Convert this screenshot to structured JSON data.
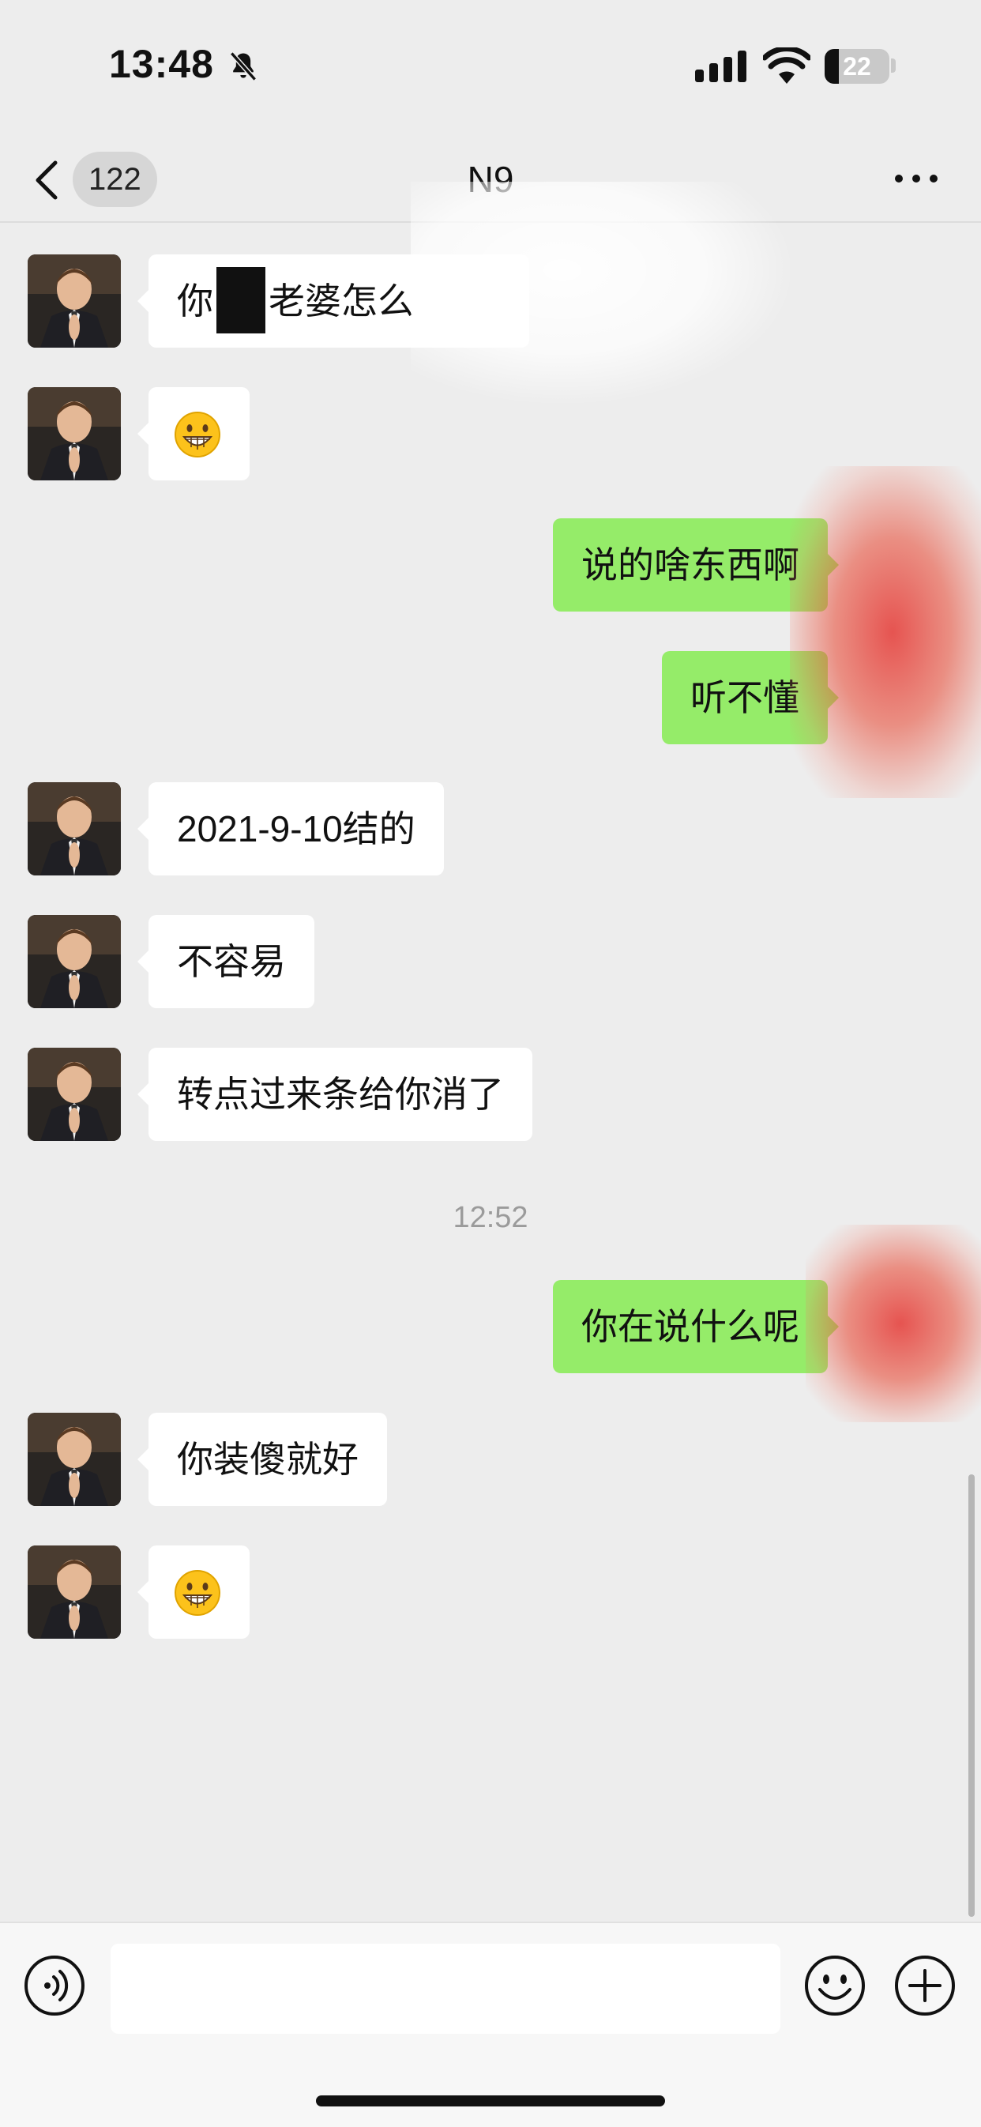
{
  "status_bar": {
    "time": "13:48",
    "battery_percent": "22",
    "icons": [
      "bell-slash-icon",
      "cellular-signal-icon",
      "wifi-icon",
      "battery-icon"
    ]
  },
  "nav": {
    "back_icon": "chevron-left-icon",
    "unread_count": "122",
    "title": "N9",
    "more_icon": "ellipsis-icon"
  },
  "messages": [
    {
      "side": "left",
      "text_before": "你",
      "text_after": "老婆怎么",
      "redacted": true
    },
    {
      "side": "left",
      "emoji": "grinning-face-icon"
    },
    {
      "side": "right",
      "text": "说的啥东西啊"
    },
    {
      "side": "right",
      "text": "听不懂"
    },
    {
      "side": "left",
      "text": "2021-9-10结的"
    },
    {
      "side": "left",
      "text": "不容易"
    },
    {
      "side": "left",
      "text": "转点过来条给你消了"
    },
    {
      "side": "right",
      "text": "你在说什么呢"
    },
    {
      "side": "left",
      "text": "你装傻就好"
    },
    {
      "side": "left",
      "emoji": "grinning-face-icon"
    }
  ],
  "timestamp": "12:52",
  "input_bar": {
    "voice_icon": "voice-icon",
    "input_value": "",
    "emoji_icon": "smiley-icon",
    "plus_icon": "plus-circle-icon"
  },
  "colors": {
    "background": "#ededed",
    "sent_bubble": "#95ec69",
    "received_bubble": "#ffffff",
    "timestamp": "#9b9b9b"
  }
}
